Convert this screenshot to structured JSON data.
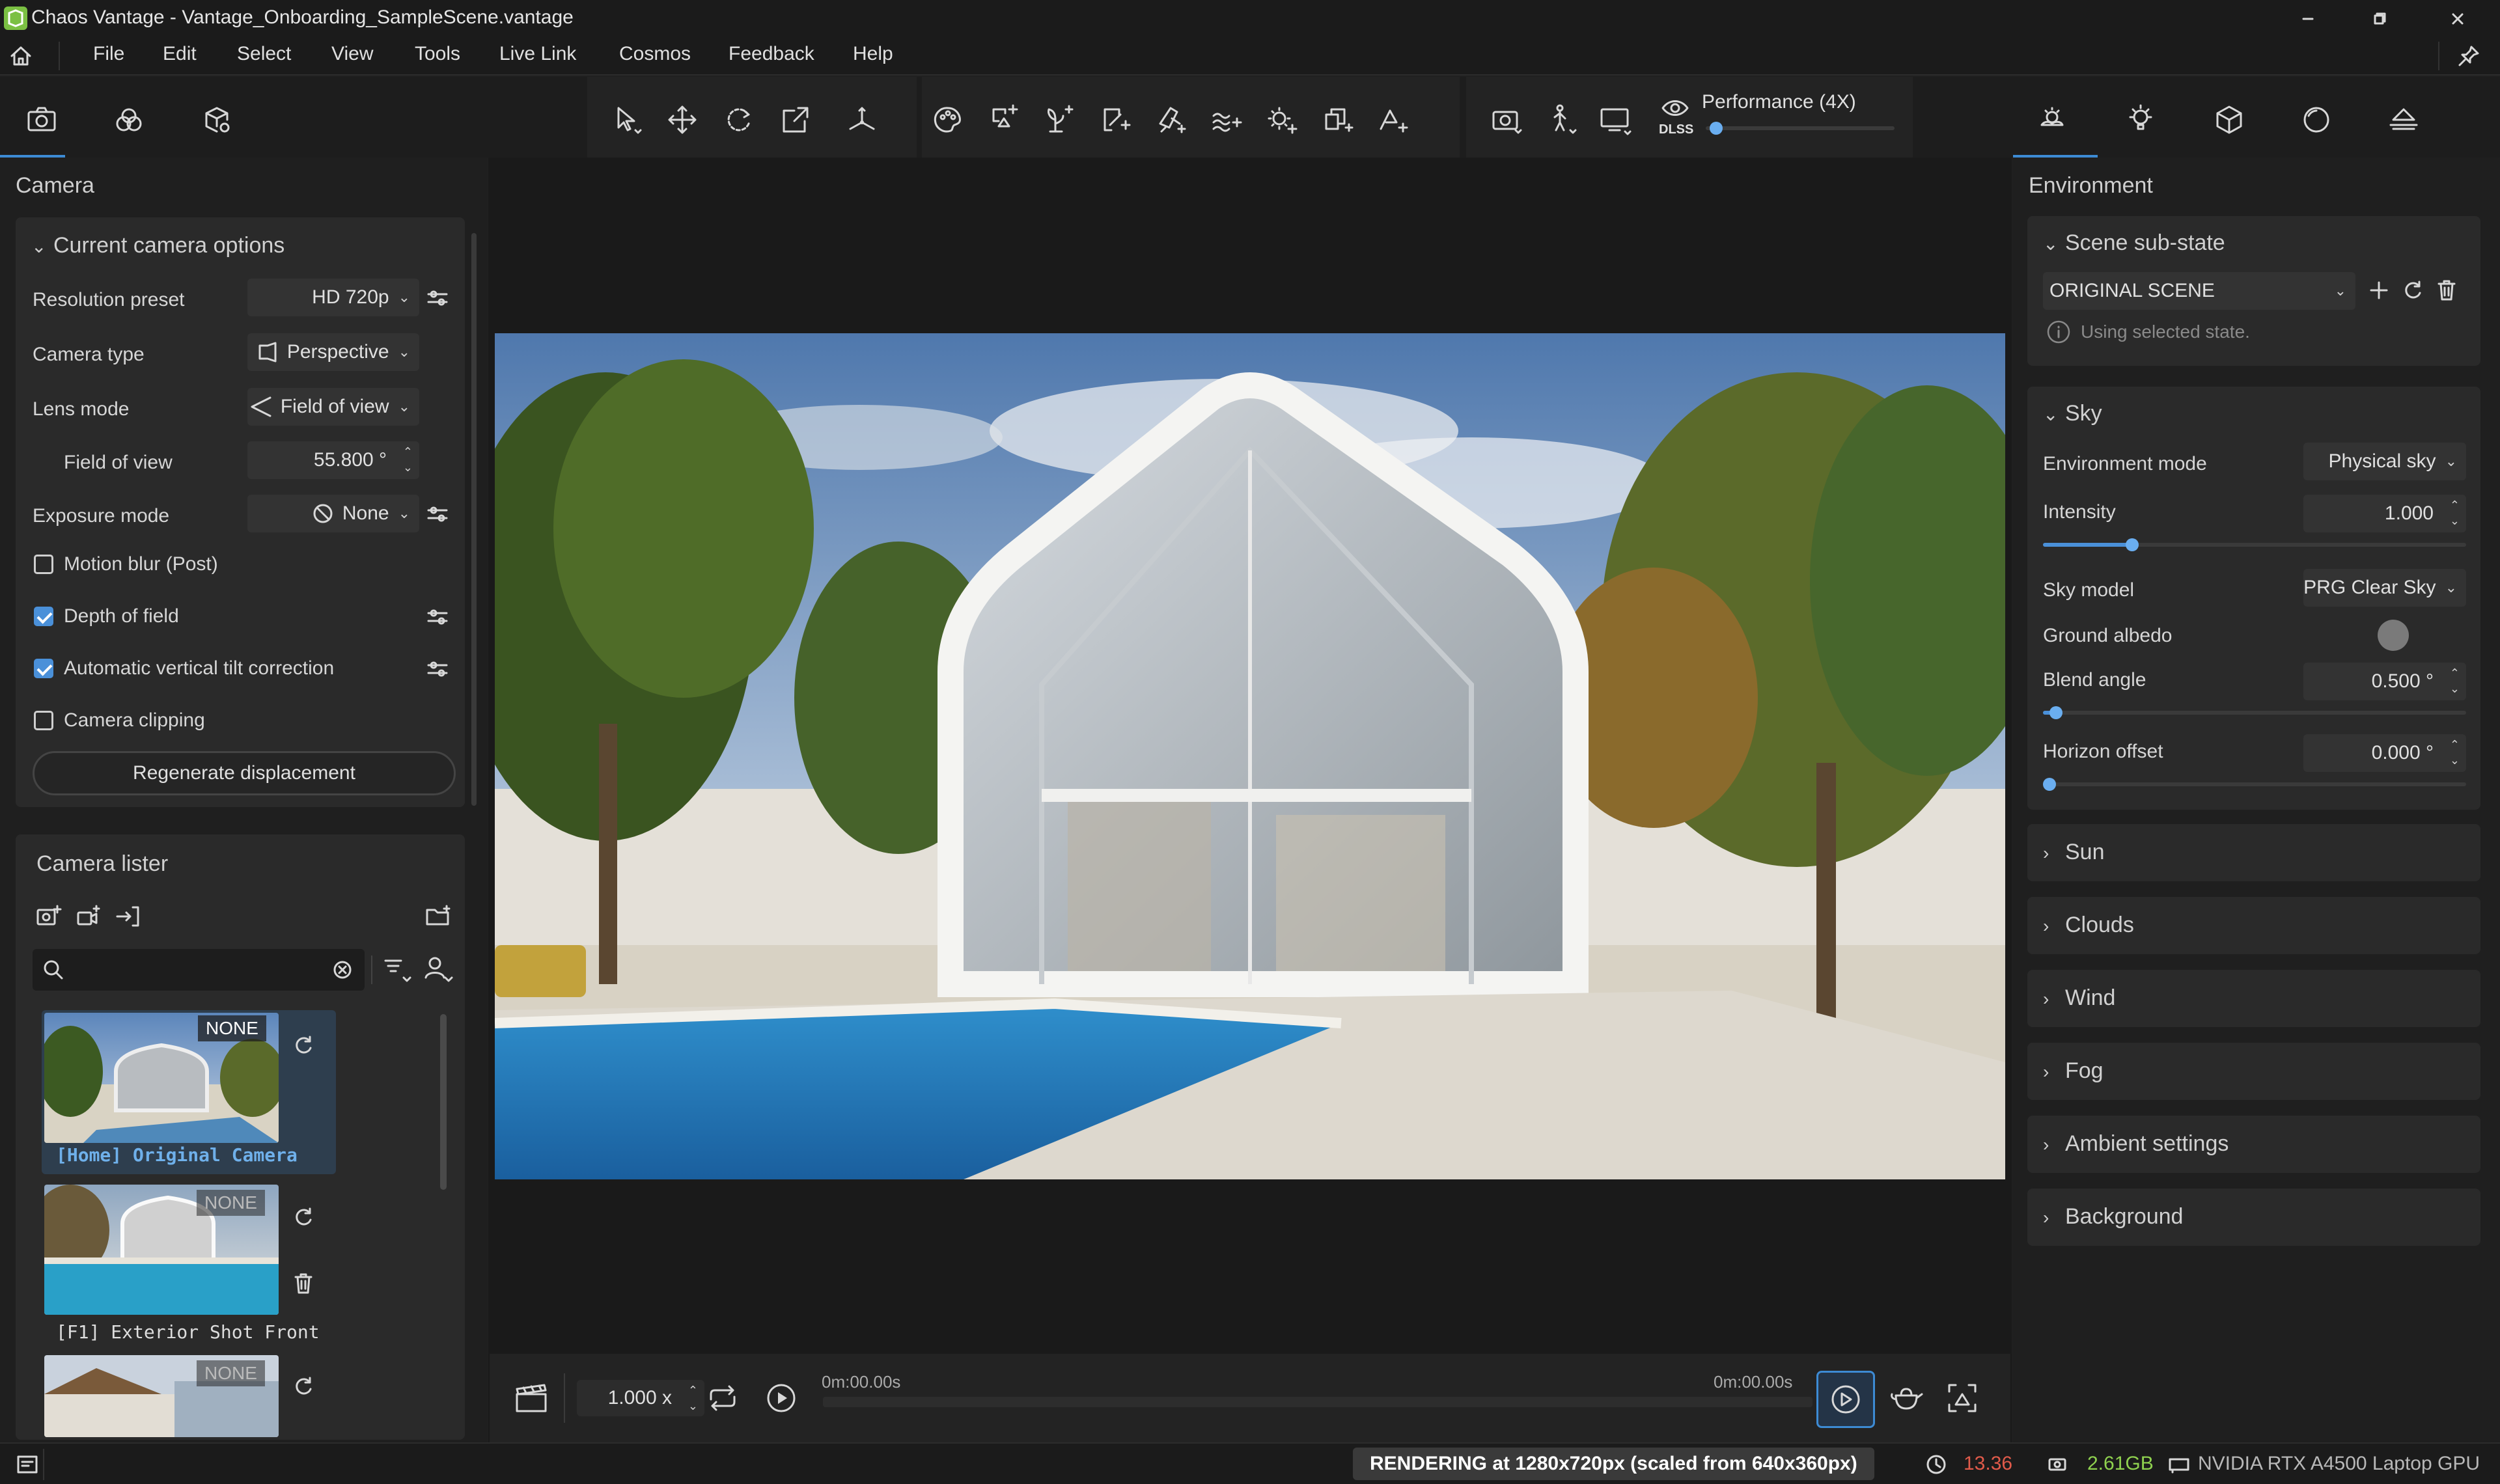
{
  "window": {
    "app_name": "Chaos Vantage",
    "title": "Chaos Vantage - Vantage_Onboarding_SampleScene.vantage",
    "controls": [
      "minimize-icon",
      "restore-icon",
      "close-icon"
    ]
  },
  "menu": {
    "items": [
      "File",
      "Edit",
      "Select",
      "View",
      "Tools",
      "Live Link",
      "Cosmos",
      "Feedback",
      "Help"
    ]
  },
  "toolbar": {
    "left_tabs": [
      "camera-icon",
      "materials-icon",
      "scene-settings-icon"
    ],
    "transform_tools": [
      "select-arrow-icon",
      "move-icon",
      "rotate-icon",
      "scale-icon",
      "pivot-icon"
    ],
    "create_tools": [
      "material-palette-icon",
      "scatter-add-icon",
      "plant-add-icon",
      "decal-add-icon",
      "paint-add-icon",
      "wave-add-icon",
      "light-add-icon",
      "instance-add-icon",
      "object-add-icon"
    ],
    "view_tools": [
      "snapshot-icon",
      "walk-icon",
      "monitor-icon"
    ],
    "dlss_label": "DLSS",
    "performance_label": "Performance (4X)",
    "performance_value": 0.02,
    "right_tabs": [
      "environment-icon",
      "lights-icon",
      "objects-icon",
      "post-effects-icon",
      "scene-layers-icon"
    ]
  },
  "camera_panel": {
    "title": "Camera",
    "section_title": "Current camera options",
    "resolution_preset": {
      "label": "Resolution preset",
      "value": "HD 720p"
    },
    "camera_type": {
      "label": "Camera type",
      "value": "Perspective"
    },
    "lens_mode": {
      "label": "Lens mode",
      "value": "Field of view"
    },
    "field_of_view": {
      "label": "Field of view",
      "value": "55.800 °"
    },
    "exposure_mode": {
      "label": "Exposure mode",
      "value": "None"
    },
    "checkboxes": [
      {
        "label": "Motion blur (Post)",
        "checked": false
      },
      {
        "label": "Depth of field",
        "checked": true
      },
      {
        "label": "Automatic vertical tilt correction",
        "checked": true
      },
      {
        "label": "Camera clipping",
        "checked": false
      }
    ],
    "regenerate_label": "Regenerate displacement"
  },
  "camera_lister": {
    "title": "Camera lister",
    "search_placeholder": "",
    "cameras": [
      {
        "name": "[Home] Original Camera",
        "badge": "NONE",
        "selected": true
      },
      {
        "name": "[F1] Exterior Shot Front",
        "badge": "NONE",
        "selected": false
      },
      {
        "name": "",
        "badge": "NONE",
        "selected": false
      }
    ]
  },
  "environment_panel": {
    "title": "Environment",
    "scene_substate": {
      "title": "Scene sub-state",
      "value": "ORIGINAL SCENE",
      "info": "Using selected state."
    },
    "sky": {
      "title": "Sky",
      "environment_mode": {
        "label": "Environment mode",
        "value": "Physical sky"
      },
      "intensity": {
        "label": "Intensity",
        "value": "1.000",
        "level": 0.21
      },
      "sky_model": {
        "label": "Sky model",
        "value": "PRG Clear Sky"
      },
      "ground_albedo": {
        "label": "Ground albedo",
        "color": "#7a7a7a"
      },
      "blend_angle": {
        "label": "Blend angle",
        "value": "0.500 °",
        "level": 0.03
      },
      "horizon_offset": {
        "label": "Horizon offset",
        "value": "0.000 °",
        "level": 0.0
      }
    },
    "collapsed_sections": [
      "Sun",
      "Clouds",
      "Wind",
      "Fog",
      "Ambient settings",
      "Background"
    ]
  },
  "timeline": {
    "speed": "1.000 x",
    "time_start": "0m:00.00s",
    "time_end": "0m:00.00s"
  },
  "status": {
    "render_text": "RENDERING at 1280x720px (scaled from 640x360px)",
    "fps": "13.36",
    "vram": "2.61GB",
    "gpu": "NVIDIA RTX A4500 Laptop GPU",
    "fps_color": "#e05a4a",
    "vram_color": "#8fd14f"
  },
  "colors": {
    "accent": "#4a90d9",
    "panel_bg": "#1f1f1f",
    "section_bg": "#2a2a2a"
  }
}
